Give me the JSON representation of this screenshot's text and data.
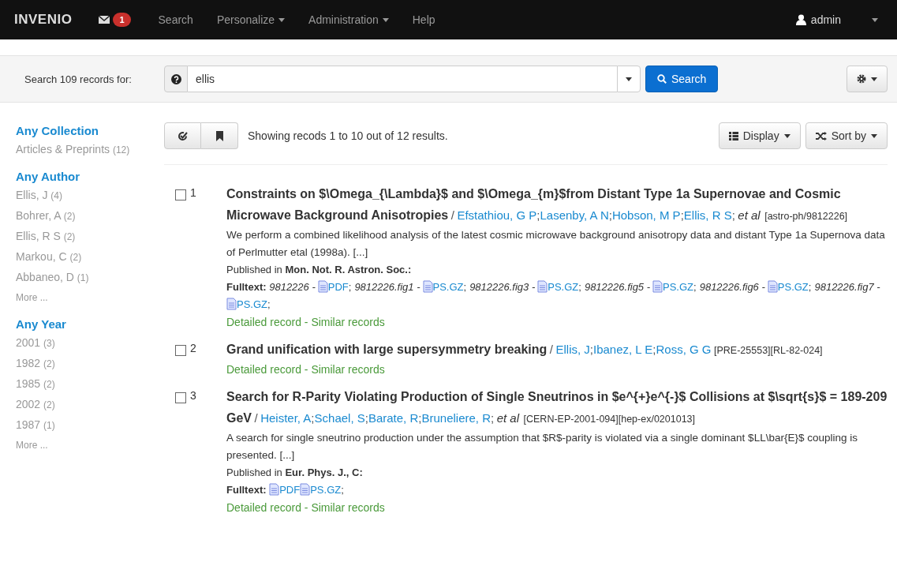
{
  "navbar": {
    "logo": "INVENIO",
    "messages_badge": "1",
    "items": [
      {
        "label": "Search",
        "dropdown": false
      },
      {
        "label": "Personalize",
        "dropdown": true
      },
      {
        "label": "Administration",
        "dropdown": true
      },
      {
        "label": "Help",
        "dropdown": false
      }
    ],
    "user": "admin"
  },
  "search_bar": {
    "label": "Search 109 records for:",
    "value": "ellis",
    "button": "Search"
  },
  "sidebar": {
    "facets": [
      {
        "title": "Any Collection",
        "items": [
          {
            "label": "Articles & Preprints",
            "count": "(12)"
          }
        ]
      },
      {
        "title": "Any Author",
        "items": [
          {
            "label": "Ellis, J",
            "count": "(4)"
          },
          {
            "label": "Bohrer, A",
            "count": "(2)"
          },
          {
            "label": "Ellis, R S",
            "count": "(2)"
          },
          {
            "label": "Markou, C",
            "count": "(2)"
          },
          {
            "label": "Abbaneo, D",
            "count": "(1)"
          }
        ],
        "more": "More ..."
      },
      {
        "title": "Any Year",
        "items": [
          {
            "label": "2001",
            "count": "(3)"
          },
          {
            "label": "1982",
            "count": "(2)"
          },
          {
            "label": "1985",
            "count": "(2)"
          },
          {
            "label": "2002",
            "count": "(2)"
          },
          {
            "label": "1987",
            "count": "(1)"
          }
        ],
        "more": "More ..."
      }
    ]
  },
  "toolbar": {
    "summary": "Showing recods 1 to 10 out of 12 results.",
    "display": "Display",
    "sort": "Sort by"
  },
  "results": {
    "byline_separator": "/",
    "author_separator": ";",
    "link_separator": "-",
    "records": [
      {
        "checked": false,
        "number": "1",
        "title": "Constraints on $\\Omega_{\\Lambda}$ and $\\Omega_{m}$from Distant Type 1a Supernovae and Cosmic Microwave Background Anisotropies",
        "authors": [
          "Efstathiou, G P",
          "Lasenby, A N",
          "Hobson, M P",
          "Ellis, R S"
        ],
        "et_al": "et al",
        "reports": [
          "[astro-ph/9812226]"
        ],
        "abstract": "We perform a combined likelihood analysis of the latest cosmic microwave background anisotropy data and distant Type 1a Supernova data of Perlmutter etal (1998a). [...]",
        "published_label": "Published in",
        "journal": "Mon. Not. R. Astron. Soc.:",
        "fulltext_label": "Fulltext:",
        "files": [
          {
            "name": "9812226 -",
            "format": "PDF",
            "sep": ";"
          },
          {
            "name": "9812226.fig1 -",
            "format": "PS.GZ",
            "sep": ";"
          },
          {
            "name": "9812226.fig3 -",
            "format": "PS.GZ",
            "sep": ";"
          },
          {
            "name": "9812226.fig5 -",
            "format": "PS.GZ",
            "sep": ";"
          },
          {
            "name": "9812226.fig6 -",
            "format": "PS.GZ",
            "sep": ";"
          },
          {
            "name": "9812226.fig7 -",
            "format": "PS.GZ",
            "sep": ";"
          }
        ],
        "links": [
          "Detailed record",
          "Similar records"
        ]
      },
      {
        "checked": false,
        "number": "2",
        "title": "Grand unification with large supersymmetry breaking",
        "authors": [
          "Ellis, J",
          "Ibanez, L E",
          "Ross, G G"
        ],
        "reports": [
          "[PRE-25553]",
          "[RL-82-024]"
        ],
        "links": [
          "Detailed record",
          "Similar records"
        ]
      },
      {
        "checked": false,
        "number": "3",
        "title": "Search for R-Parity Violating Production of Single Sneutrinos in $e^{+}e^{-}$ Collisions at $\\sqrt{s}$ = 189-209 GeV",
        "authors": [
          "Heister, A",
          "Schael, S",
          "Barate, R",
          "Bruneliere, R"
        ],
        "et_al": "et al",
        "reports": [
          "[CERN-EP-2001-094]",
          "[hep-ex/0201013]"
        ],
        "abstract": "A search for single sneutrino production under the assumption that $R$-parity is violated via a single dominant $LL\\bar{E}$ coupling is presented. [...]",
        "published_label": "Published in",
        "journal": "Eur. Phys. J., C:",
        "fulltext_label": "Fulltext:",
        "files": [
          {
            "format": "PDF"
          },
          {
            "format": "PS.GZ",
            "sep": ";"
          }
        ],
        "links": [
          "Detailed record",
          "Similar records"
        ]
      }
    ]
  }
}
